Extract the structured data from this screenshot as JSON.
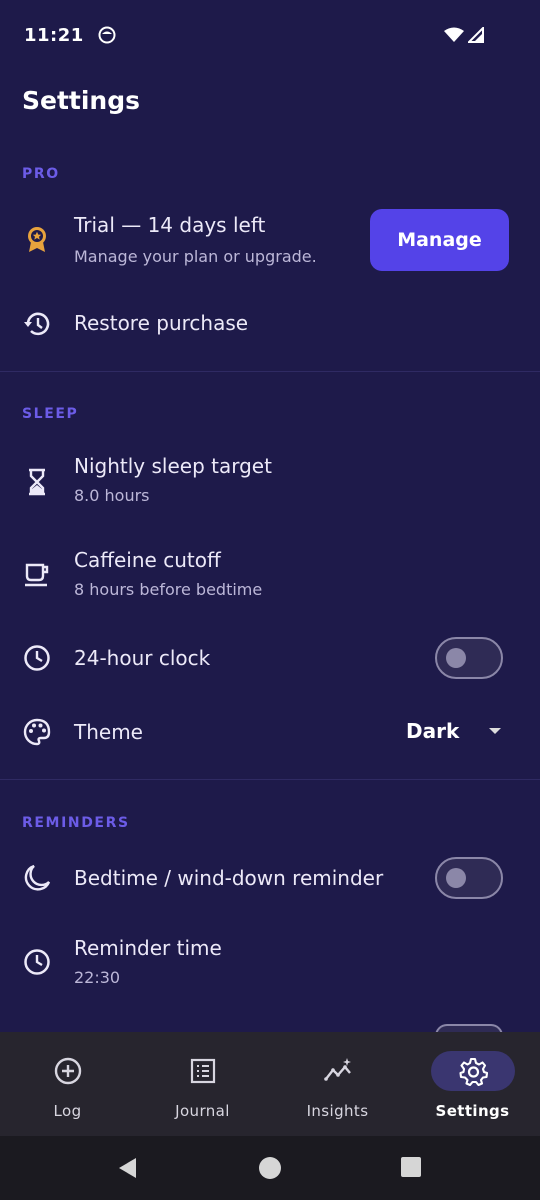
{
  "status_bar": {
    "time": "11:21"
  },
  "page": {
    "title": "Settings"
  },
  "sections": {
    "pro": "PRO",
    "sleep": "SLEEP",
    "reminders": "REMINDERS"
  },
  "pro": {
    "trial_title": "Trial — 14 days left",
    "trial_subtitle": "Manage your plan or upgrade.",
    "manage_label": "Manage",
    "restore_label": "Restore purchase"
  },
  "sleep": {
    "target_title": "Nightly sleep target",
    "target_value": "8.0 hours",
    "caffeine_title": "Caffeine cutoff",
    "caffeine_value": "8 hours before bedtime",
    "clock_title": "24-hour clock",
    "clock_enabled": false,
    "theme_title": "Theme",
    "theme_value": "Dark"
  },
  "reminders": {
    "bedtime_title": "Bedtime / wind-down reminder",
    "bedtime_enabled": false,
    "time_title": "Reminder time",
    "time_value": "22:30"
  },
  "bottom_nav": {
    "items": [
      {
        "label": "Log",
        "icon": "plus-circle-icon",
        "active": false
      },
      {
        "label": "Journal",
        "icon": "list-icon",
        "active": false
      },
      {
        "label": "Insights",
        "icon": "trend-sparkle-icon",
        "active": false
      },
      {
        "label": "Settings",
        "icon": "gear-icon",
        "active": true
      }
    ]
  },
  "colors": {
    "background": "#1e1a4a",
    "accent": "#5443e8",
    "section_header": "#6c5ce7",
    "nav_background": "#27252e"
  }
}
